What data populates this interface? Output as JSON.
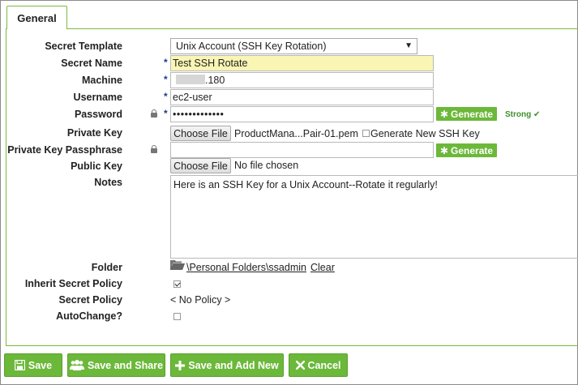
{
  "tabs": [
    {
      "label": "General"
    }
  ],
  "form": {
    "secret_template": {
      "label": "Secret Template",
      "value": "Unix Account (SSH Key Rotation)"
    },
    "secret_name": {
      "label": "Secret Name",
      "value": "Test SSH Rotate",
      "required": "*"
    },
    "machine": {
      "label": "Machine",
      "value": ".180",
      "required": "*"
    },
    "username": {
      "label": "Username",
      "value": "ec2-user",
      "required": "*"
    },
    "password": {
      "label": "Password",
      "value": "•••••••••••••",
      "required": "*",
      "generate_label": "Generate",
      "strength": "Strong"
    },
    "private_key": {
      "label": "Private Key",
      "choose_label": "Choose File",
      "file_name": "ProductMana...Pair-01.pem",
      "generate_new_label": "Generate New SSH Key"
    },
    "private_key_passphrase": {
      "label": "Private Key Passphrase",
      "value": "",
      "generate_label": "Generate"
    },
    "public_key": {
      "label": "Public Key",
      "choose_label": "Choose File",
      "file_name": "No file chosen"
    },
    "notes": {
      "label": "Notes",
      "value": "Here is an SSH Key for a Unix Account--Rotate it regularly!"
    },
    "folder": {
      "label": "Folder",
      "path": "\\Personal Folders\\ssadmin",
      "clear_label": "Clear"
    },
    "inherit_secret_policy": {
      "label": "Inherit Secret Policy",
      "checked": true
    },
    "secret_policy": {
      "label": "Secret Policy",
      "value": "< No Policy >"
    },
    "autochange": {
      "label": "AutoChange?",
      "checked": false
    }
  },
  "actions": {
    "save": "Save",
    "save_and_share": "Save and Share",
    "save_and_add_new": "Save and Add New",
    "cancel": "Cancel"
  },
  "colors": {
    "accent": "#6cb83a",
    "required_star": "#1a3c8a",
    "strong": "#3f8f2c",
    "highlight": "#f9f6b5"
  },
  "icons": [
    "lock-icon",
    "asterisk-icon",
    "check-icon",
    "folder-open-icon",
    "save-icon",
    "users-icon",
    "plus-icon",
    "x-icon"
  ]
}
